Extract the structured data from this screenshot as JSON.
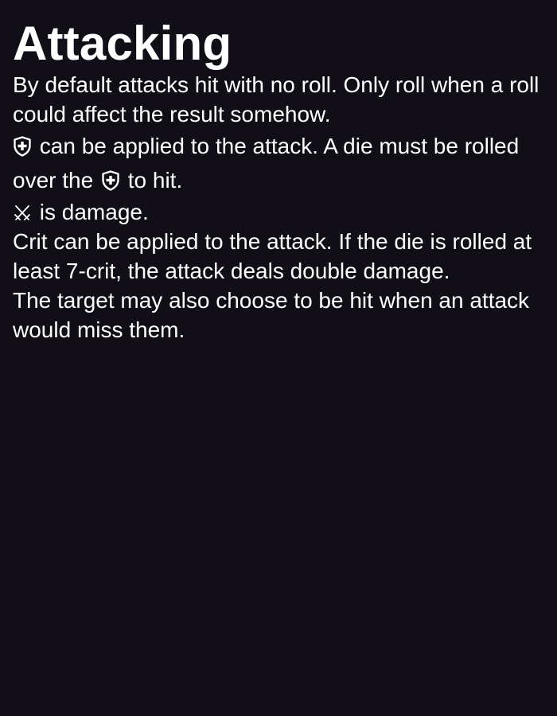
{
  "title": "Attacking",
  "paragraphs": {
    "p1": "By default attacks hit with no roll. Only roll when a roll could affect the result somehow.",
    "p2_a": "can be applied to the attack. A die must be rolled over the",
    "p2_b": "to hit.",
    "p3": "is damage.",
    "p4": "Crit can be applied to the attack. If the die is rolled at least 7-crit, the attack deals double damage.",
    "p5": "The target may also choose to be hit when an attack would miss them."
  },
  "icons": {
    "armor": "shield-plus-icon",
    "damage": "crossed-swords-icon"
  },
  "colors": {
    "background": "#120e18",
    "text": "#ffffff"
  }
}
